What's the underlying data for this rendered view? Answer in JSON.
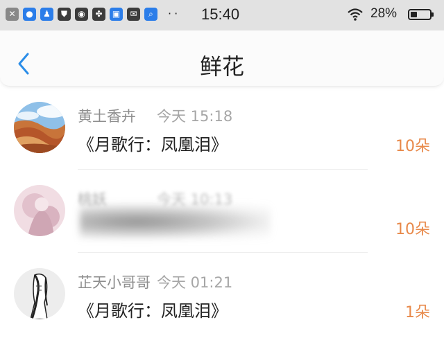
{
  "status_bar": {
    "time": "15:40",
    "battery": "28%",
    "dots": "··",
    "icons": [
      "close-notification-icon",
      "baidu-paw-icon",
      "qq-penguin-icon",
      "shield-icon",
      "game-controller-icon",
      "pinwheel-icon",
      "app-store-icon",
      "mail-icon",
      "search-app-icon"
    ]
  },
  "nav": {
    "back_glyph": "<",
    "title": "鲜花"
  },
  "items": [
    {
      "name": "黄土香卉",
      "time": "今天 15:18",
      "title": "《月歌行：凤凰泪》",
      "count": "10朵"
    },
    {
      "name": "桃妖",
      "time": "今天 10:13",
      "title": "",
      "count": "10朵"
    },
    {
      "name": "芷天小哥哥",
      "time": "今天 01:21",
      "title": "《月歌行：凤凰泪》",
      "count": "1朵"
    }
  ],
  "colors": {
    "accent_count": "#e8894a",
    "back_arrow": "#2b8de8",
    "status_bar_bg": "#e2e2e2"
  }
}
